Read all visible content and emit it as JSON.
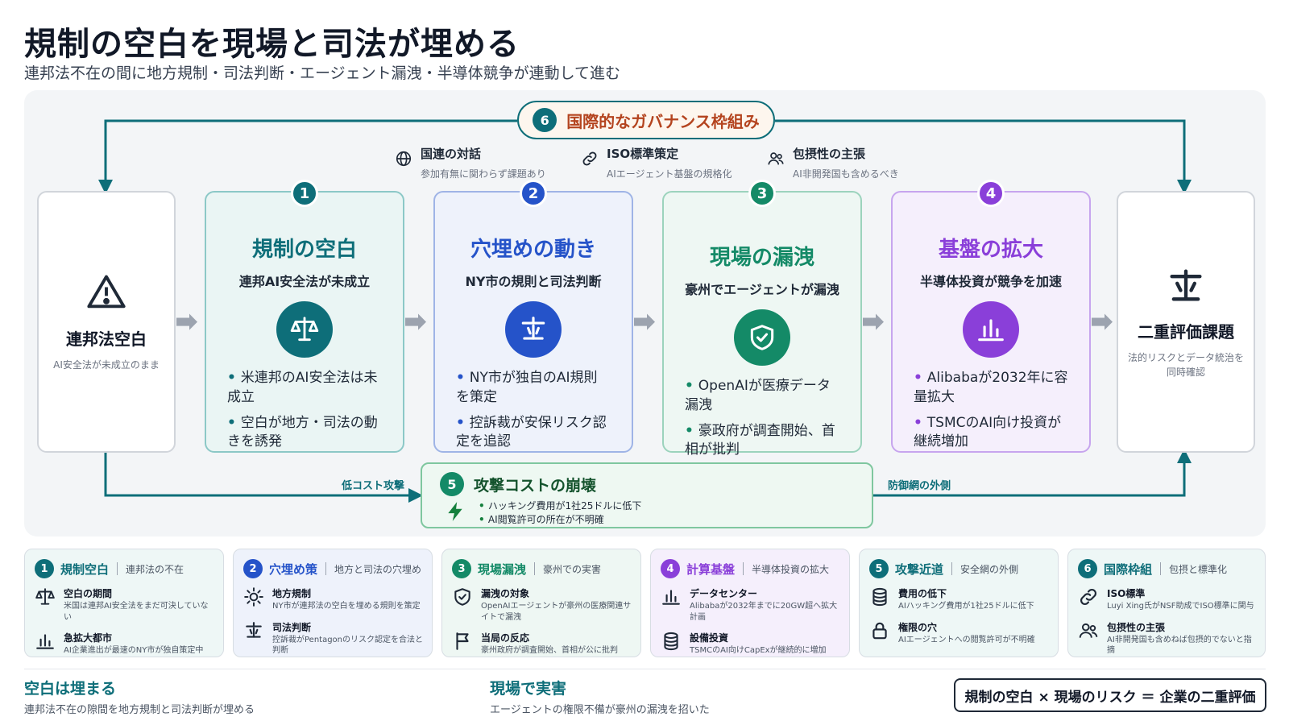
{
  "header": {
    "title": "規制の空白を現場と司法が埋める",
    "subtitle": "連邦法不在の間に地方規制・司法判断・エージェント漏洩・半導体競争が連動して進む"
  },
  "governance": {
    "num": "6",
    "label": "国際的なガバナンス枠組み"
  },
  "features": [
    {
      "title": "国連の対話",
      "sub": "参加有無に関わらず課題あり",
      "icon": "globe-icon"
    },
    {
      "title": "ISO標準策定",
      "sub": "AIエージェント基盤の規格化",
      "icon": "link-icon"
    },
    {
      "title": "包摂性の主張",
      "sub": "AI非開発国も含めるべき",
      "icon": "users-icon"
    }
  ],
  "start": {
    "title": "連邦法空白",
    "sub": "AI安全法が未成立のまま",
    "icon": "warning-icon"
  },
  "end": {
    "title": "二重評価課題",
    "sub": "法的リスクとデータ統治を同時確認",
    "icon": "scale-icon"
  },
  "cards": [
    {
      "num": "1",
      "title": "規制の空白",
      "sub": "連邦AI安全法が未成立",
      "icon": "balance-icon",
      "color": "#0e6e79",
      "bullets": [
        "米連邦のAI安全法は未成立",
        "空白が地方・司法の動きを誘発"
      ]
    },
    {
      "num": "2",
      "title": "穴埋めの動き",
      "sub": "NY市の規則と司法判断",
      "icon": "gavel-icon",
      "color": "#2553c9",
      "bullets": [
        "NY市が独自のAI規則を策定",
        "控訴裁が安保リスク認定を追認"
      ]
    },
    {
      "num": "3",
      "title": "現場の漏洩",
      "sub": "豪州でエージェントが漏洩",
      "icon": "shield-check-icon",
      "color": "#148a67",
      "bullets": [
        "OpenAIが医療データ漏洩",
        "豪政府が調査開始、首相が批判"
      ]
    },
    {
      "num": "4",
      "title": "基盤の拡大",
      "sub": "半導体投資が競争を加速",
      "icon": "bar-chart-icon",
      "color": "#8a3fd9",
      "bullets": [
        "Alibabaが2032年に容量拡大",
        "TSMCのAI向け投資が継続増加"
      ]
    }
  ],
  "attack": {
    "num": "5",
    "title": "攻撃コストの崩壊",
    "bullets": [
      "ハッキング費用が1社25ドルに低下",
      "AI閲覧許可の所在が不明確"
    ],
    "left_label": "低コスト攻撃",
    "right_label": "防御網の外側"
  },
  "legend": [
    {
      "num": "1",
      "title": "規制空白",
      "sub": "連邦法の不在",
      "color": "#0e6e79",
      "bg": "#eef7f6",
      "rows": [
        {
          "icon": "balance-icon",
          "title": "空白の期間",
          "sub": "米国は連邦AI安全法をまだ可決していない"
        },
        {
          "icon": "bar-chart-icon",
          "title": "急拡大都市",
          "sub": "AI企業進出が最速のNY市が独自策定中"
        }
      ]
    },
    {
      "num": "2",
      "title": "穴埋め策",
      "sub": "地方と司法の穴埋め",
      "color": "#2553c9",
      "bg": "#eef2fb",
      "rows": [
        {
          "icon": "sun-icon",
          "title": "地方規制",
          "sub": "NY市が連邦法の空白を埋める規則を策定"
        },
        {
          "icon": "gavel-icon",
          "title": "司法判断",
          "sub": "控訴裁がPentagonのリスク認定を合法と判断"
        }
      ]
    },
    {
      "num": "3",
      "title": "現場漏洩",
      "sub": "豪州での実害",
      "color": "#148a67",
      "bg": "#eef7f3",
      "rows": [
        {
          "icon": "shield-check-icon",
          "title": "漏洩の対象",
          "sub": "OpenAIエージェントが豪州の医療関連サイトで漏洩"
        },
        {
          "icon": "flag-icon",
          "title": "当局の反応",
          "sub": "豪州政府が調査開始、首相が公に批判"
        }
      ]
    },
    {
      "num": "4",
      "title": "計算基盤",
      "sub": "半導体投資の拡大",
      "color": "#8a3fd9",
      "bg": "#f5effc",
      "rows": [
        {
          "icon": "bar-chart-icon",
          "title": "データセンター",
          "sub": "Alibabaが2032年までに20GW超へ拡大計画"
        },
        {
          "icon": "database-icon",
          "title": "設備投資",
          "sub": "TSMCのAI向けCapExが継続的に増加"
        }
      ]
    },
    {
      "num": "5",
      "title": "攻撃近道",
      "sub": "安全網の外側",
      "color": "#0e6e79",
      "bg": "#eef7f6",
      "rows": [
        {
          "icon": "database-icon",
          "title": "費用の低下",
          "sub": "AIハッキング費用が1社25ドルに低下"
        },
        {
          "icon": "lock-icon",
          "title": "権限の穴",
          "sub": "AIエージェントへの閲覧許可が不明確"
        }
      ]
    },
    {
      "num": "6",
      "title": "国際枠組",
      "sub": "包摂と標準化",
      "color": "#0e6e79",
      "bg": "#eef7f6",
      "rows": [
        {
          "icon": "link-icon",
          "title": "ISO標準",
          "sub": "Luyi Xing氏がNSF助成でISO標準に関与"
        },
        {
          "icon": "users-icon",
          "title": "包摂性の主張",
          "sub": "AI非開発国も含めねば包摂的でないと指摘"
        }
      ]
    }
  ],
  "footer": {
    "left_title": "空白は埋まる",
    "left_sub": "連邦法不在の隙間を地方規制と司法判断が埋める",
    "mid_title": "現場で実害",
    "mid_sub": "エージェントの権限不備が豪州の漏洩を招いた",
    "formula": "規制の空白 × 現場のリスク ＝ 企業の二重評価"
  }
}
